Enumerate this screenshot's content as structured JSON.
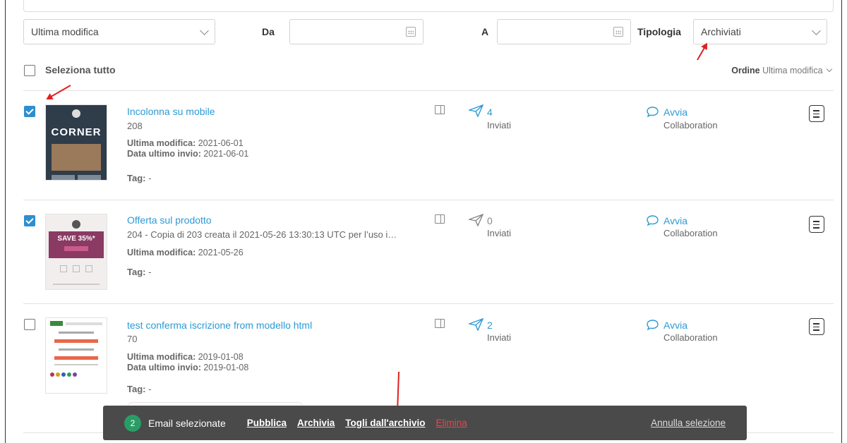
{
  "filters": {
    "sort_by": "Ultima modifica",
    "from_label": "Da",
    "from_value": "",
    "to_label": "A",
    "to_value": "",
    "type_label": "Tipologia",
    "type_value": "Archiviati"
  },
  "list_header": {
    "select_all": "Seleziona tutto",
    "order_label": "Ordine",
    "order_value": "Ultima modifica"
  },
  "emails": [
    {
      "title": "Incolonna su mobile",
      "id_text": "208",
      "last_modified_label": "Ultima modifica:",
      "last_modified": "2021-06-01",
      "last_sent_label": "Data ultimo invio:",
      "last_sent": "2021-06-01",
      "tag_label": "Tag:",
      "tag_value": "-",
      "sent_count": "4",
      "sent_label": "Inviati",
      "collab_action": "Avvia",
      "collab_label": "Collaboration",
      "checked": true,
      "thumb_text": "CORNER"
    },
    {
      "title": "Offerta sul prodotto",
      "id_text": "204 - Copia di 203 creata il 2021-05-26 13:30:13 UTC per l’uso i…",
      "last_modified_label": "Ultima modifica:",
      "last_modified": "2021-05-26",
      "tag_label": "Tag:",
      "tag_value": "-",
      "sent_count": "0",
      "sent_label": "Inviati",
      "collab_action": "Avvia",
      "collab_label": "Collaboration",
      "checked": true,
      "thumb_text": "SAVE 35%*"
    },
    {
      "title": "test conferma iscrizione from modello html",
      "id_text": "70",
      "last_modified_label": "Ultima modifica:",
      "last_modified": "2019-01-08",
      "last_sent_label": "Data ultimo invio:",
      "last_sent": "2019-01-08",
      "tag_label": "Tag:",
      "tag_value": "-",
      "sent_count": "2",
      "sent_label": "Inviati",
      "collab_action": "Avvia",
      "collab_label": "Collaboration",
      "checked": false
    }
  ],
  "action_bar": {
    "count": "2",
    "selected_label": "Email selezionate",
    "publish": "Pubblica",
    "archive": "Archivia",
    "unarchive": "Togli dall'archivio",
    "delete": "Elimina",
    "cancel": "Annulla selezione"
  },
  "colors": {
    "link": "#2d9ad4",
    "checked": "#2d8fcf",
    "annotation": "#e02020",
    "badge": "#2a9d67",
    "delete": "#e5484d"
  }
}
